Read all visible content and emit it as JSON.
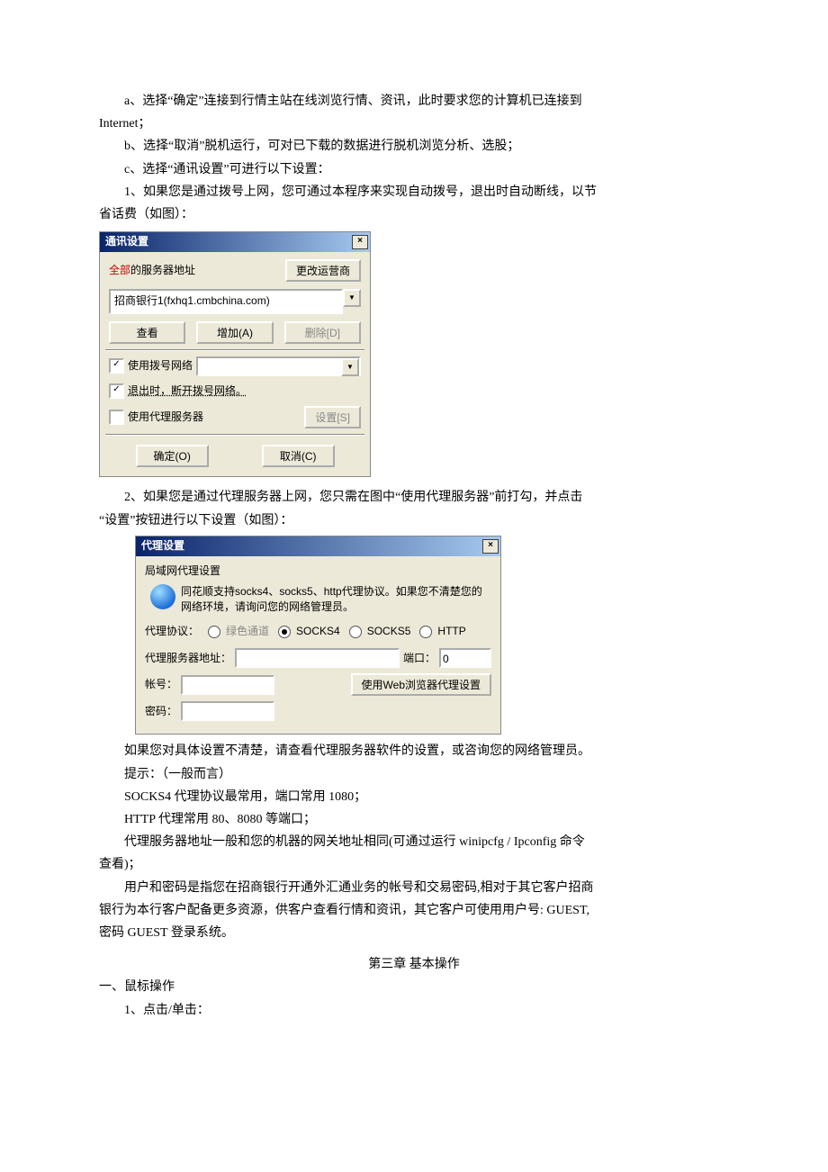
{
  "paragraphs": {
    "a": "a、选择“确定”连接到行情主站在线浏览行情、资讯，此时要求您的计算机已连接到Internet；",
    "a_line1": "a、选择“确定”连接到行情主站在线浏览行情、资讯，此时要求您的计算机已连接到",
    "a_line2": "Internet；",
    "b": "b、选择“取消”脱机运行，可对已下载的数据进行脱机浏览分析、选股；",
    "c": "c、选择“通讯设置”可进行以下设置：",
    "p1": "1、如果您是通过拨号上网，您可通过本程序来实现自动拨号，退出时自动断线，以节省话费（如图）：",
    "p1_line1": "1、如果您是通过拨号上网，您可通过本程序来实现自动拨号，退出时自动断线，以节",
    "p1_line2": "省话费（如图）：",
    "p2": "2、如果您是通过代理服务器上网，您只需在图中“使用代理服务器”前打勾，并点击“设置”按钮进行以下设置（如图）：",
    "p2_line1": "2、如果您是通过代理服务器上网，您只需在图中“使用代理服务器”前打勾，并点击",
    "p2_line2": "“设置”按钮进行以下设置（如图）：",
    "after1": "如果您对具体设置不清楚，请查看代理服务器软件的设置，或咨询您的网络管理员。",
    "after2": "提示：（一般而言）",
    "after3": "SOCKS4 代理协议最常用，端口常用 1080；",
    "after4": "HTTP 代理常用 80、8080 等端口；",
    "after5_line1": "代理服务器地址一般和您的机器的网关地址相同(可通过运行 winipcfg / Ipconfig 命令",
    "after5_line2": "查看)；",
    "after6_line1": "用户和密码是指您在招商银行开通外汇通业务的帐号和交易密码,相对于其它客户招商",
    "after6_line2": "银行为本行客户配备更多资源，供客户查看行情和资讯，其它客户可使用用户号: GUEST,",
    "after6_line3": "密码 GUEST 登录系统。",
    "chapter": "第三章 基本操作",
    "sec1": "一、鼠标操作",
    "sec1_1": "1、点击/单击："
  },
  "dialog1": {
    "title": "通讯设置",
    "close": "×",
    "all": "全部",
    "all_suffix": "的服务器地址",
    "change_btn": "更改运营商",
    "server_sel": "招商银行1(fxhq1.cmbchina.com)",
    "view_btn": "查看",
    "add_btn": "增加(A)",
    "del_btn": "删除[D]",
    "chk_dial": "使用拨号网络",
    "chk_exit": "退出时，断开拨号网络。",
    "chk_proxy": "使用代理服务器",
    "cfg_btn": "设置[S]",
    "ok_btn": "确定(O)",
    "cancel_btn": "取消(C)"
  },
  "dialog2": {
    "title": "代理设置",
    "close": "×",
    "group": "局域网代理设置",
    "info": "同花顺支持socks4、socks5、http代理协议。如果您不清楚您的网络环境，请询问您的网络管理员。",
    "proto_lbl": "代理协议：",
    "r1": "绿色通道",
    "r2": "SOCKS4",
    "r3": "SOCKS5",
    "r4": "HTTP",
    "addr_lbl": "代理服务器地址：",
    "port_lbl": "端口：",
    "port_val": "0",
    "acc_lbl": "帐号：",
    "webbtn": "使用Web浏览器代理设置",
    "pwd_lbl": "密码："
  }
}
